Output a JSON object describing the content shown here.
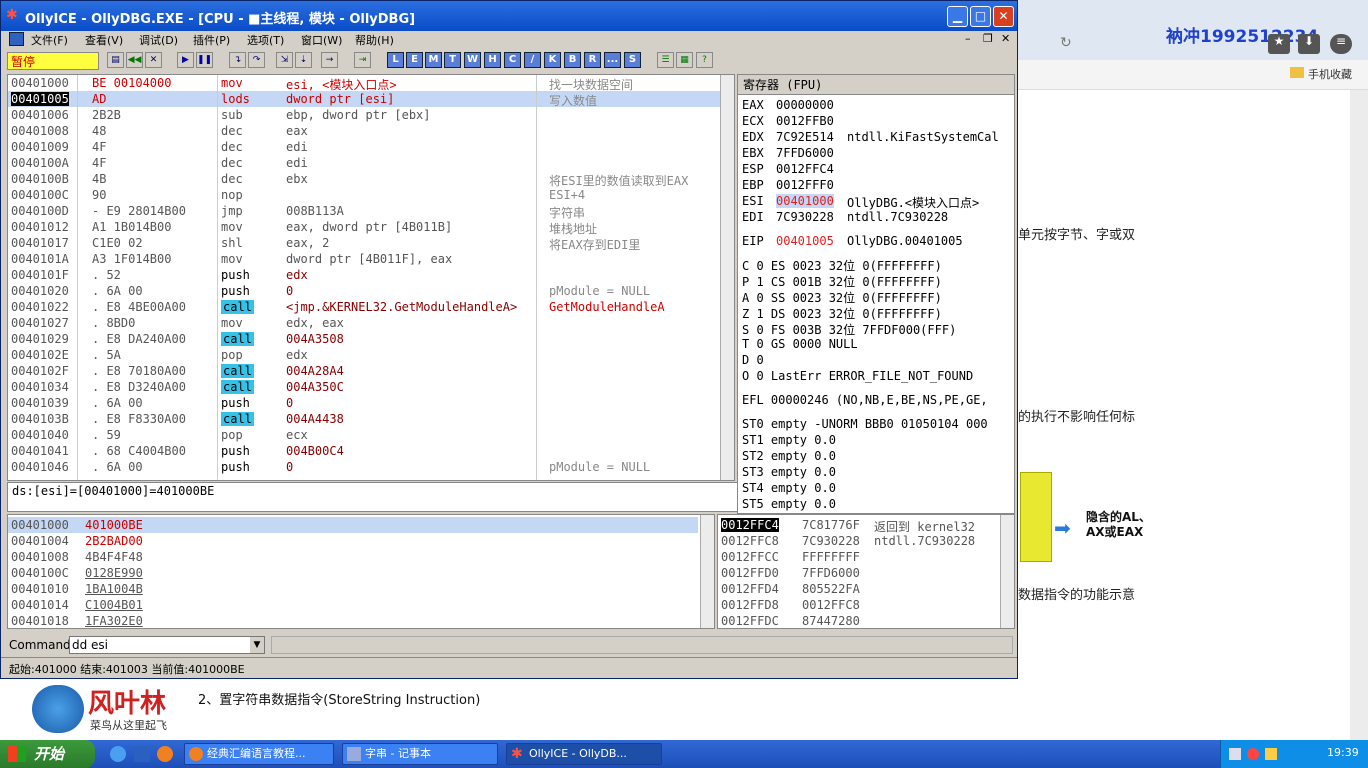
{
  "window": {
    "title": "OllyICE - OllyDBG.EXE - [CPU - ■主线程, 模块 - OllyDBG]"
  },
  "menu": [
    "文件(F)",
    "查看(V)",
    "调试(D)",
    "插件(P)",
    "选项(T)",
    "窗口(W)",
    "帮助(H)"
  ],
  "toolbar": {
    "status": "暂停",
    "letters": [
      "L",
      "E",
      "M",
      "T",
      "W",
      "H",
      "C",
      "/",
      "K",
      "B",
      "R",
      "...",
      "S"
    ]
  },
  "disasm": [
    {
      "addr": "00401000",
      "hex": "BE 00104000",
      "mn": "mov",
      "op": "esi, <模块入口点>",
      "cm": "找一块数据空间",
      "sel": false
    },
    {
      "addr": "00401005",
      "hex": "AD",
      "mn": "lods",
      "op": "dword ptr [esi]",
      "cm": "写入数值",
      "sel": true
    },
    {
      "addr": "00401006",
      "hex": "2B2B",
      "mn": "sub",
      "op": "ebp, dword ptr [ebx]",
      "cm": ""
    },
    {
      "addr": "00401008",
      "hex": "48",
      "mn": "dec",
      "op": "eax",
      "cm": ""
    },
    {
      "addr": "00401009",
      "hex": "4F",
      "mn": "dec",
      "op": "edi",
      "cm": ""
    },
    {
      "addr": "0040100A",
      "hex": "4F",
      "mn": "dec",
      "op": "edi",
      "cm": ""
    },
    {
      "addr": "0040100B",
      "hex": "4B",
      "mn": "dec",
      "op": "ebx",
      "cm": "将ESI里的数值读取到EAX"
    },
    {
      "addr": "0040100C",
      "hex": "90",
      "mn": "nop",
      "op": "",
      "cm": "ESI+4"
    },
    {
      "addr": "0040100D",
      "hex": "- E9 28014B00",
      "mn": "jmp",
      "op": "008B113A",
      "cm": "字符串"
    },
    {
      "addr": "00401012",
      "hex": "A1 1B014B00",
      "mn": "mov",
      "op": "eax, dword ptr [4B011B]",
      "cm": "堆栈地址"
    },
    {
      "addr": "00401017",
      "hex": "C1E0 02",
      "mn": "shl",
      "op": "eax, 2",
      "cm": "将EAX存到EDI里"
    },
    {
      "addr": "0040101A",
      "hex": "A3 1F014B00",
      "mn": "mov",
      "op": "dword ptr [4B011F], eax",
      "cm": ""
    },
    {
      "addr": "0040101F",
      "hex": ". 52",
      "mn": "push",
      "op": "edx",
      "cm": ""
    },
    {
      "addr": "00401020",
      "hex": ". 6A 00",
      "mn": "push",
      "op": "0",
      "cm": "pModule = NULL"
    },
    {
      "addr": "00401022",
      "hex": ". E8 4BE00A00",
      "mn": "call",
      "op": "<jmp.&KERNEL32.GetModuleHandleA>",
      "cm": "GetModuleHandleA"
    },
    {
      "addr": "00401027",
      "hex": ". 8BD0",
      "mn": "mov",
      "op": "edx, eax",
      "cm": ""
    },
    {
      "addr": "00401029",
      "hex": ". E8 DA240A00",
      "mn": "call",
      "op": "004A3508",
      "cm": ""
    },
    {
      "addr": "0040102E",
      "hex": ". 5A",
      "mn": "pop",
      "op": "edx",
      "cm": ""
    },
    {
      "addr": "0040102F",
      "hex": ". E8 70180A00",
      "mn": "call",
      "op": "004A28A4",
      "cm": ""
    },
    {
      "addr": "00401034",
      "hex": ". E8 D3240A00",
      "mn": "call",
      "op": "004A350C",
      "cm": ""
    },
    {
      "addr": "00401039",
      "hex": ". 6A 00",
      "mn": "push",
      "op": "0",
      "cm": ""
    },
    {
      "addr": "0040103B",
      "hex": ". E8 F8330A00",
      "mn": "call",
      "op": "004A4438",
      "cm": ""
    },
    {
      "addr": "00401040",
      "hex": ". 59",
      "mn": "pop",
      "op": "ecx",
      "cm": ""
    },
    {
      "addr": "00401041",
      "hex": ". 68 C4004B00",
      "mn": "push",
      "op": "004B00C4",
      "cm": ""
    },
    {
      "addr": "00401046",
      "hex": ". 6A 00",
      "mn": "push",
      "op": "0",
      "cm": "pModule = NULL"
    }
  ],
  "info": "ds:[esi]=[00401000]=401000BE",
  "registers": {
    "title": "寄存器 (FPU)",
    "rows": [
      {
        "k": "EAX",
        "v": "00000000",
        "d": ""
      },
      {
        "k": "ECX",
        "v": "0012FFB0",
        "d": ""
      },
      {
        "k": "EDX",
        "v": "7C92E514",
        "d": "ntdll.KiFastSystemCal"
      },
      {
        "k": "EBX",
        "v": "7FFD6000",
        "d": ""
      },
      {
        "k": "ESP",
        "v": "0012FFC4",
        "d": ""
      },
      {
        "k": "EBP",
        "v": "0012FFF0",
        "d": ""
      },
      {
        "k": "ESI",
        "v": "00401000",
        "d": "OllyDBG.<模块入口点>"
      },
      {
        "k": "EDI",
        "v": "7C930228",
        "d": "ntdll.7C930228"
      }
    ],
    "eip": {
      "k": "EIP",
      "v": "00401005",
      "d": "OllyDBG.00401005"
    },
    "flags": [
      "C 0  ES 0023 32位 0(FFFFFFFF)",
      "P 1  CS 001B 32位 0(FFFFFFFF)",
      "A 0  SS 0023 32位 0(FFFFFFFF)",
      "Z 1  DS 0023 32位 0(FFFFFFFF)",
      "S 0  FS 003B 32位 7FFDF000(FFF)",
      "T 0  GS 0000 NULL",
      "D 0",
      "O 0  LastErr ERROR_FILE_NOT_FOUND"
    ],
    "efl": "EFL 00000246 (NO,NB,E,BE,NS,PE,GE,",
    "fpu": [
      "ST0 empty -UNORM BBB0 01050104 000",
      "ST1 empty 0.0",
      "ST2 empty 0.0",
      "ST3 empty 0.0",
      "ST4 empty 0.0",
      "ST5 empty 0.0"
    ]
  },
  "dump": [
    {
      "a": "00401000",
      "v": "401000BE"
    },
    {
      "a": "00401004",
      "v": "2B2BAD00"
    },
    {
      "a": "00401008",
      "v": "4B4F4F48"
    },
    {
      "a": "0040100C",
      "v": "0128E990"
    },
    {
      "a": "00401010",
      "v": "1BA1004B"
    },
    {
      "a": "00401014",
      "v": "C1004B01"
    },
    {
      "a": "00401018",
      "v": "1FA302E0"
    }
  ],
  "stack": [
    {
      "a": "0012FFC4",
      "v": "7C81776F",
      "c": "返回到 kernel32"
    },
    {
      "a": "0012FFC8",
      "v": "7C930228",
      "c": "ntdll.7C930228"
    },
    {
      "a": "0012FFCC",
      "v": "FFFFFFFF",
      "c": ""
    },
    {
      "a": "0012FFD0",
      "v": "7FFD6000",
      "c": ""
    },
    {
      "a": "0012FFD4",
      "v": "805522FA",
      "c": ""
    },
    {
      "a": "0012FFD8",
      "v": "0012FFC8",
      "c": ""
    },
    {
      "a": "0012FFDC",
      "v": "87447280",
      "c": ""
    }
  ],
  "command": {
    "label": "Command",
    "value": "dd esi"
  },
  "statusline": "起始:401000 结束:401003 当前值:401000BE",
  "bgpage": {
    "watermark": "衲冲1992512234",
    "bookmark": "手机收藏",
    "text1": "单元按字节、字或双",
    "text2": "的执行不影响任何标",
    "box": "隐含的AL、AX或EAX",
    "text3": "数据指令的功能示意",
    "caption": "2、置字符串数据指令(StoreString Instruction)",
    "logo": "风叶林",
    "slogan": "菜鸟从这里起飞"
  },
  "taskbar": {
    "start": "开始",
    "tasks": [
      "经典汇编语言教程...",
      "字串 - 记事本",
      "OllyICE - OllyDB..."
    ],
    "time": "19:39"
  }
}
